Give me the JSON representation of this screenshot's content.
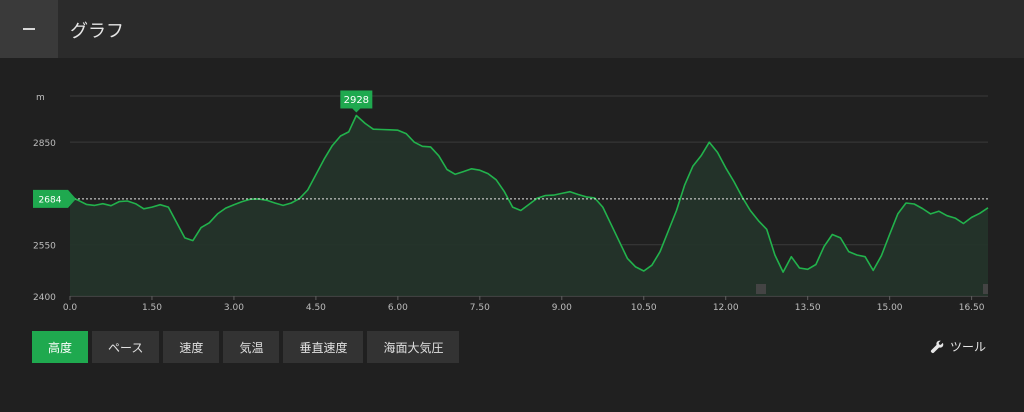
{
  "header": {
    "title": "グラフ",
    "menu_icon": "minus-icon"
  },
  "colors": {
    "accent": "#1fa94f",
    "line": "#22b24c",
    "fill": "#23342a"
  },
  "tabs": [
    {
      "label": "高度",
      "active": true
    },
    {
      "label": "ペース",
      "active": false
    },
    {
      "label": "速度",
      "active": false
    },
    {
      "label": "気温",
      "active": false
    },
    {
      "label": "垂直速度",
      "active": false
    },
    {
      "label": "海面大気圧",
      "active": false
    }
  ],
  "tools": {
    "label": "ツール",
    "icon": "wrench-icon"
  },
  "chart_data": {
    "type": "area",
    "ylabel": "m",
    "xlim": [
      0,
      16.8
    ],
    "ylim": [
      2400,
      2985
    ],
    "y_ticks": [
      2400,
      2550,
      2850
    ],
    "x_ticks": [
      "0.0",
      "1.50",
      "3.00",
      "4.50",
      "6.00",
      "7.50",
      "9.00",
      "10.50",
      "12.00",
      "13.50",
      "15.00",
      "16.50"
    ],
    "x_tick_values": [
      0,
      1.5,
      3.0,
      4.5,
      6.0,
      7.5,
      9.0,
      10.5,
      12.0,
      13.5,
      15.0,
      16.5
    ],
    "reference_line": {
      "value": 2684,
      "label": "2684"
    },
    "max_marker": {
      "x": 5.24,
      "value": 2928,
      "label": "2928"
    },
    "x": [
      0.0,
      0.15,
      0.3,
      0.45,
      0.6,
      0.75,
      0.9,
      1.05,
      1.2,
      1.35,
      1.5,
      1.65,
      1.8,
      1.95,
      2.1,
      2.25,
      2.4,
      2.55,
      2.7,
      2.85,
      3.0,
      3.15,
      3.3,
      3.45,
      3.6,
      3.75,
      3.9,
      4.05,
      4.2,
      4.35,
      4.5,
      4.65,
      4.8,
      4.95,
      5.1,
      5.24,
      5.4,
      5.55,
      5.7,
      5.85,
      6.0,
      6.15,
      6.3,
      6.45,
      6.6,
      6.75,
      6.9,
      7.05,
      7.2,
      7.35,
      7.5,
      7.65,
      7.8,
      7.95,
      8.1,
      8.25,
      8.4,
      8.55,
      8.7,
      8.85,
      9.0,
      9.15,
      9.3,
      9.45,
      9.6,
      9.75,
      9.9,
      10.05,
      10.2,
      10.35,
      10.5,
      10.65,
      10.8,
      10.95,
      11.1,
      11.25,
      11.4,
      11.55,
      11.7,
      11.85,
      12.0,
      12.15,
      12.3,
      12.45,
      12.6,
      12.75,
      12.9,
      13.05,
      13.2,
      13.35,
      13.5,
      13.65,
      13.8,
      13.95,
      14.1,
      14.25,
      14.4,
      14.55,
      14.7,
      14.85,
      15.0,
      15.15,
      15.3,
      15.45,
      15.6,
      15.75,
      15.9,
      16.05,
      16.2,
      16.35,
      16.5,
      16.65,
      16.8
    ],
    "y": [
      2690,
      2680,
      2668,
      2665,
      2670,
      2664,
      2676,
      2678,
      2670,
      2655,
      2660,
      2667,
      2660,
      2615,
      2570,
      2562,
      2600,
      2614,
      2640,
      2657,
      2667,
      2676,
      2683,
      2684,
      2680,
      2672,
      2665,
      2672,
      2685,
      2710,
      2755,
      2800,
      2840,
      2868,
      2880,
      2928,
      2905,
      2888,
      2887,
      2886,
      2885,
      2875,
      2850,
      2838,
      2836,
      2810,
      2770,
      2756,
      2764,
      2772,
      2768,
      2758,
      2740,
      2705,
      2660,
      2650,
      2668,
      2686,
      2694,
      2695,
      2700,
      2705,
      2697,
      2690,
      2687,
      2660,
      2610,
      2560,
      2510,
      2485,
      2473,
      2490,
      2530,
      2590,
      2650,
      2725,
      2780,
      2810,
      2850,
      2820,
      2775,
      2735,
      2690,
      2650,
      2620,
      2595,
      2520,
      2470,
      2515,
      2482,
      2478,
      2492,
      2545,
      2580,
      2570,
      2530,
      2520,
      2515,
      2475,
      2518,
      2580,
      2640,
      2672,
      2669,
      2656,
      2640,
      2648,
      2635,
      2628,
      2612,
      2630,
      2642,
      2658
    ]
  }
}
